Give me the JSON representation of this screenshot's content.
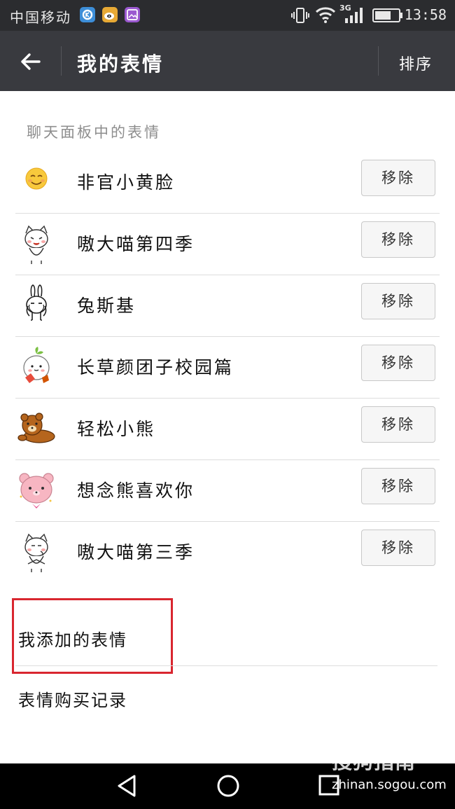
{
  "status_bar": {
    "carrier": "中国移动",
    "network": "3G",
    "time": "13:58",
    "icons": [
      "notification-app-icon",
      "weibo-icon",
      "gallery-icon",
      "vibrate-icon",
      "wifi-icon",
      "signal-icon",
      "battery-icon"
    ]
  },
  "header": {
    "title": "我的表情",
    "sort_label": "排序",
    "background": "#393a3f"
  },
  "chat_panel": {
    "title": "聊天面板中的表情",
    "remove_label": "移除",
    "items": [
      {
        "name": "非官小黄脸",
        "icon": "yellow-face-icon"
      },
      {
        "name": "嗷大喵第四季",
        "icon": "white-cat-icon"
      },
      {
        "name": "兔斯基",
        "icon": "rabbit-icon"
      },
      {
        "name": "长草颜团子校园篇",
        "icon": "dumpling-icon"
      },
      {
        "name": "轻松小熊",
        "icon": "brown-bear-icon"
      },
      {
        "name": "想念熊喜欢你",
        "icon": "pink-bear-icon"
      },
      {
        "name": "嗷大喵第三季",
        "icon": "white-cat-icon"
      }
    ]
  },
  "my_added": "我添加的表情",
  "purchase_history": "表情购买记录",
  "highlight_color": "#d9262f",
  "watermark": {
    "brand": "搜狗指南",
    "url": "zhinan.sogou.com"
  }
}
